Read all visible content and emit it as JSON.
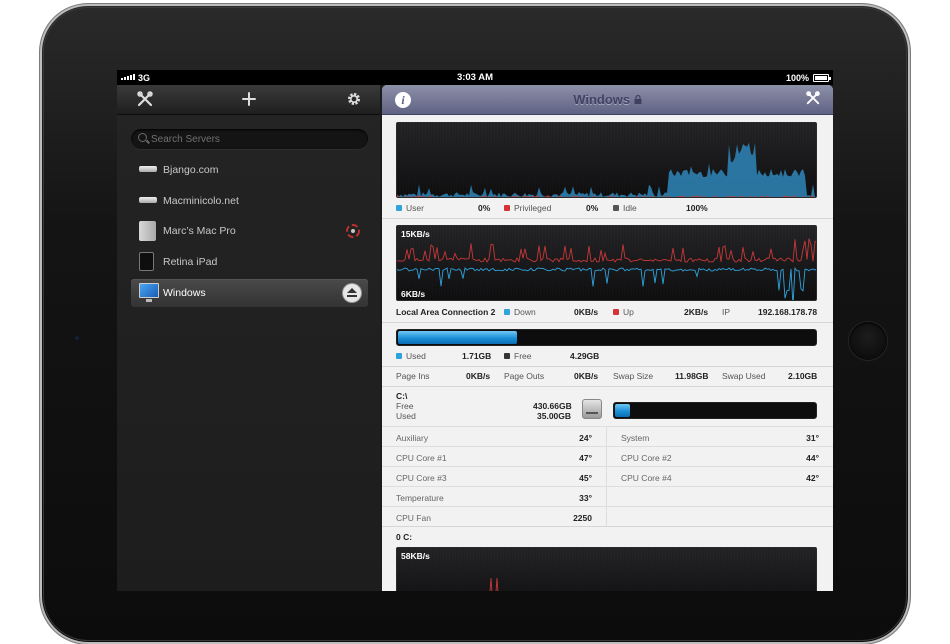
{
  "status_bar": {
    "network": "3G",
    "time": "3:03 AM",
    "battery": "100%"
  },
  "sidebar": {
    "search_placeholder": "Search Servers",
    "servers": [
      {
        "name": "Bjango.com",
        "icon": "mac-mini-icon"
      },
      {
        "name": "Macminicolo.net",
        "icon": "mac-mini-icon"
      },
      {
        "name": "Marc’s Mac Pro",
        "icon": "mac-pro-icon",
        "status": "warning"
      },
      {
        "name": "Retina iPad",
        "icon": "ipad-icon"
      },
      {
        "name": "Windows",
        "icon": "pc-monitor-icon",
        "selected": true
      }
    ]
  },
  "detail": {
    "title": "Windows",
    "locked": true,
    "cpu": {
      "legend": [
        {
          "label": "User",
          "value": "0%",
          "color": "#2fa3dc"
        },
        {
          "label": "Privileged",
          "value": "0%",
          "color": "#d63434"
        },
        {
          "label": "Idle",
          "value": "100%",
          "color": "#555555"
        }
      ]
    },
    "network": {
      "max_label": "15KB/s",
      "min_label": "6KB/s",
      "interface": "Local Area Connection 2",
      "down_label": "Down",
      "down_value": "0KB/s",
      "up_label": "Up",
      "up_value": "2KB/s",
      "ip_label": "IP",
      "ip_value": "192.168.178.78"
    },
    "memory": {
      "used_fraction": 0.285,
      "used_label": "Used",
      "used_value": "1.71GB",
      "free_label": "Free",
      "free_value": "4.29GB",
      "stats": [
        {
          "label": "Page Ins",
          "value": "0KB/s"
        },
        {
          "label": "Page Outs",
          "value": "0KB/s"
        },
        {
          "label": "Swap Size",
          "value": "11.98GB"
        },
        {
          "label": "Swap Used",
          "value": "2.10GB"
        }
      ]
    },
    "disk": {
      "name": "C:\\",
      "free_label": "Free",
      "free_value": "430.66GB",
      "used_label": "Used",
      "used_value": "35.00GB",
      "used_fraction": 0.075
    },
    "sensors": [
      {
        "label": "Auxiliary",
        "value": "24°"
      },
      {
        "label": "System",
        "value": "31°"
      },
      {
        "label": "CPU Core #1",
        "value": "47°"
      },
      {
        "label": "CPU Core #2",
        "value": "44°"
      },
      {
        "label": "CPU Core #3",
        "value": "45°"
      },
      {
        "label": "CPU Core #4",
        "value": "42°"
      },
      {
        "label": "Temperature",
        "value": "33°"
      },
      {
        "label": "CPU Fan",
        "value": "2250"
      }
    ],
    "disk_activity": {
      "name": "0 C:",
      "max_label": "58KB/s"
    }
  },
  "colors": {
    "accent_blue": "#2fa3dc",
    "accent_red": "#d63434",
    "toolbar_purple": "#6e7191"
  }
}
